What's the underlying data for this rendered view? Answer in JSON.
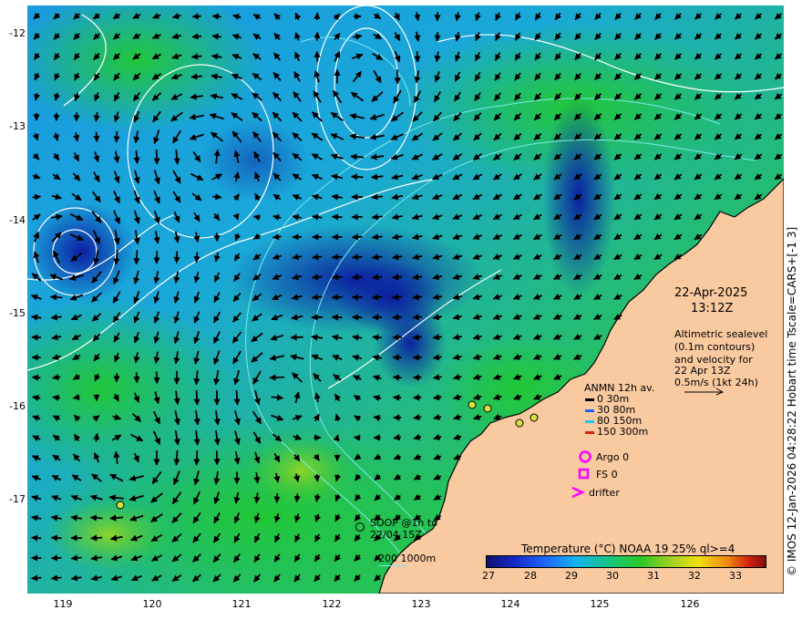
{
  "map": {
    "date": "22-Apr-2025",
    "time": "13:12Z",
    "altimetry_note": [
      "Altimetric sealevel",
      "(0.1m contours)",
      "and velocity for",
      "22 Apr 13Z",
      "0.5m/s (1kt 24h)"
    ],
    "y_ticks": [
      "-12",
      "-13",
      "-14",
      "-15",
      "-16",
      "-17"
    ],
    "x_ticks": [
      "119",
      "120",
      "121",
      "122",
      "123",
      "124",
      "125",
      "126"
    ],
    "anmn": {
      "title": "ANMN 12h av.",
      "rows": [
        {
          "label": "0 30m",
          "color": "#000000"
        },
        {
          "label": "30 80m",
          "color": "#1e64ff"
        },
        {
          "label": "80 150m",
          "color": "#14c8f0"
        },
        {
          "label": "150 300m",
          "color": "#e02010"
        }
      ]
    },
    "argo_label": "Argo 0",
    "fs_label": "FS 0",
    "drifter_label": "drifter",
    "soop_label": [
      "SOOP @1h to",
      "22/04 15Z"
    ],
    "depth_label": "200  1000m",
    "colorbar": {
      "title": "Temperature (°C) NOAA 19 25% ql>=4",
      "ticks": [
        "27",
        "28",
        "29",
        "30",
        "31",
        "32",
        "33"
      ]
    },
    "credit": "© IMOS 12-Jan-2026 04:28:22 Hobart time Tscale=CARS+[-1 3]",
    "colors": {
      "land": "#f9c9a0",
      "marker": "#ff00ff",
      "contour": "#ffffff",
      "isobath": "#7ee8e8"
    }
  }
}
